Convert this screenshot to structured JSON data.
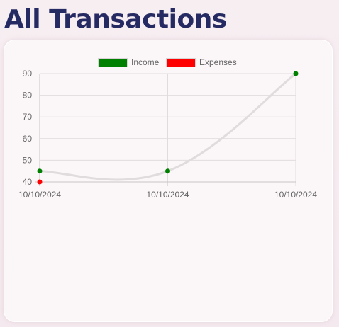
{
  "page": {
    "title": "All Transactions"
  },
  "colors": {
    "title": "#262a63",
    "income": "#008000",
    "expenses": "#ff0000",
    "line": "#e0dcde",
    "grid": "#e0dcde",
    "text": "#666666"
  },
  "chart_data": {
    "type": "line",
    "title": "",
    "xlabel": "",
    "ylabel": "",
    "categories": [
      "10/10/2024",
      "10/10/2024",
      "10/10/2024"
    ],
    "ylim": [
      40,
      90
    ],
    "yticks": [
      40,
      50,
      60,
      70,
      80,
      90
    ],
    "grid": true,
    "legend_position": "top-center",
    "series": [
      {
        "name": "Income",
        "color": "#008000",
        "values": [
          45,
          45,
          90
        ]
      },
      {
        "name": "Expenses",
        "color": "#ff0000",
        "values": [
          40,
          null,
          null
        ]
      }
    ]
  }
}
